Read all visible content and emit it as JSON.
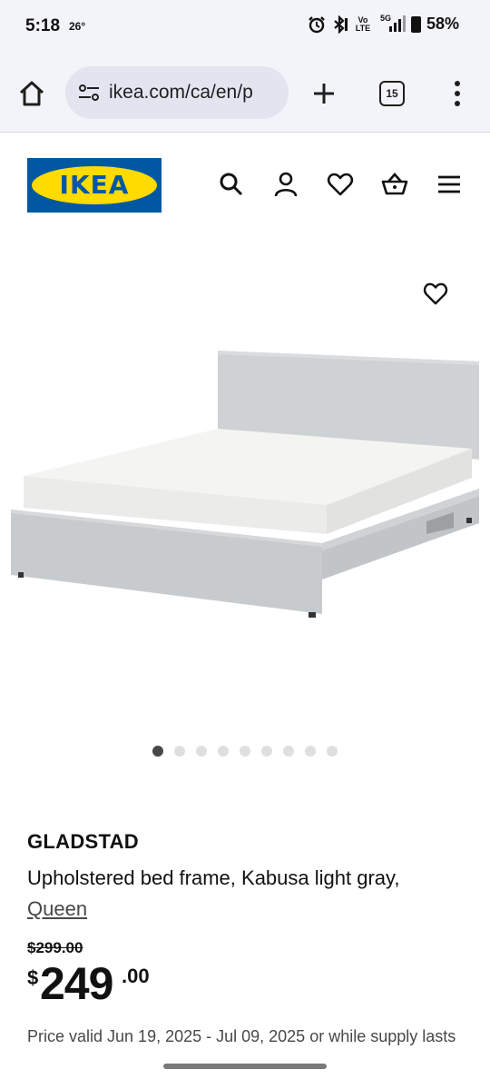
{
  "status_bar": {
    "time": "5:18",
    "temperature": "26°",
    "icons": [
      "alarm-icon",
      "bluetooth-icon",
      "volte-icon",
      "5g-signal-icon",
      "battery-icon"
    ],
    "volte": "Vo LTE",
    "network": "5G",
    "battery": "58%"
  },
  "browser": {
    "url": "ikea.com/ca/en/p",
    "tab_count": "15"
  },
  "header": {
    "logo_text": "IKEA",
    "icons": [
      "search-icon",
      "account-icon",
      "favourites-icon",
      "cart-icon",
      "menu-icon"
    ]
  },
  "gallery": {
    "image_count": 9,
    "active_index": 0
  },
  "product": {
    "name": "GLADSTAD",
    "description": "Upholstered bed frame, Kabusa light gray,",
    "size": "Queen",
    "old_price": "$299.00",
    "currency": "$",
    "price_integer": "249",
    "price_decimal": ".00",
    "validity": "Price valid Jun 19, 2025 - Jul 09, 2025 or while supply lasts"
  },
  "colors": {
    "ikea_blue": "#0058a3",
    "ikea_yellow": "#ffdb00",
    "browser_bg": "#f3f4f9",
    "url_pill": "#e2e5f0"
  }
}
